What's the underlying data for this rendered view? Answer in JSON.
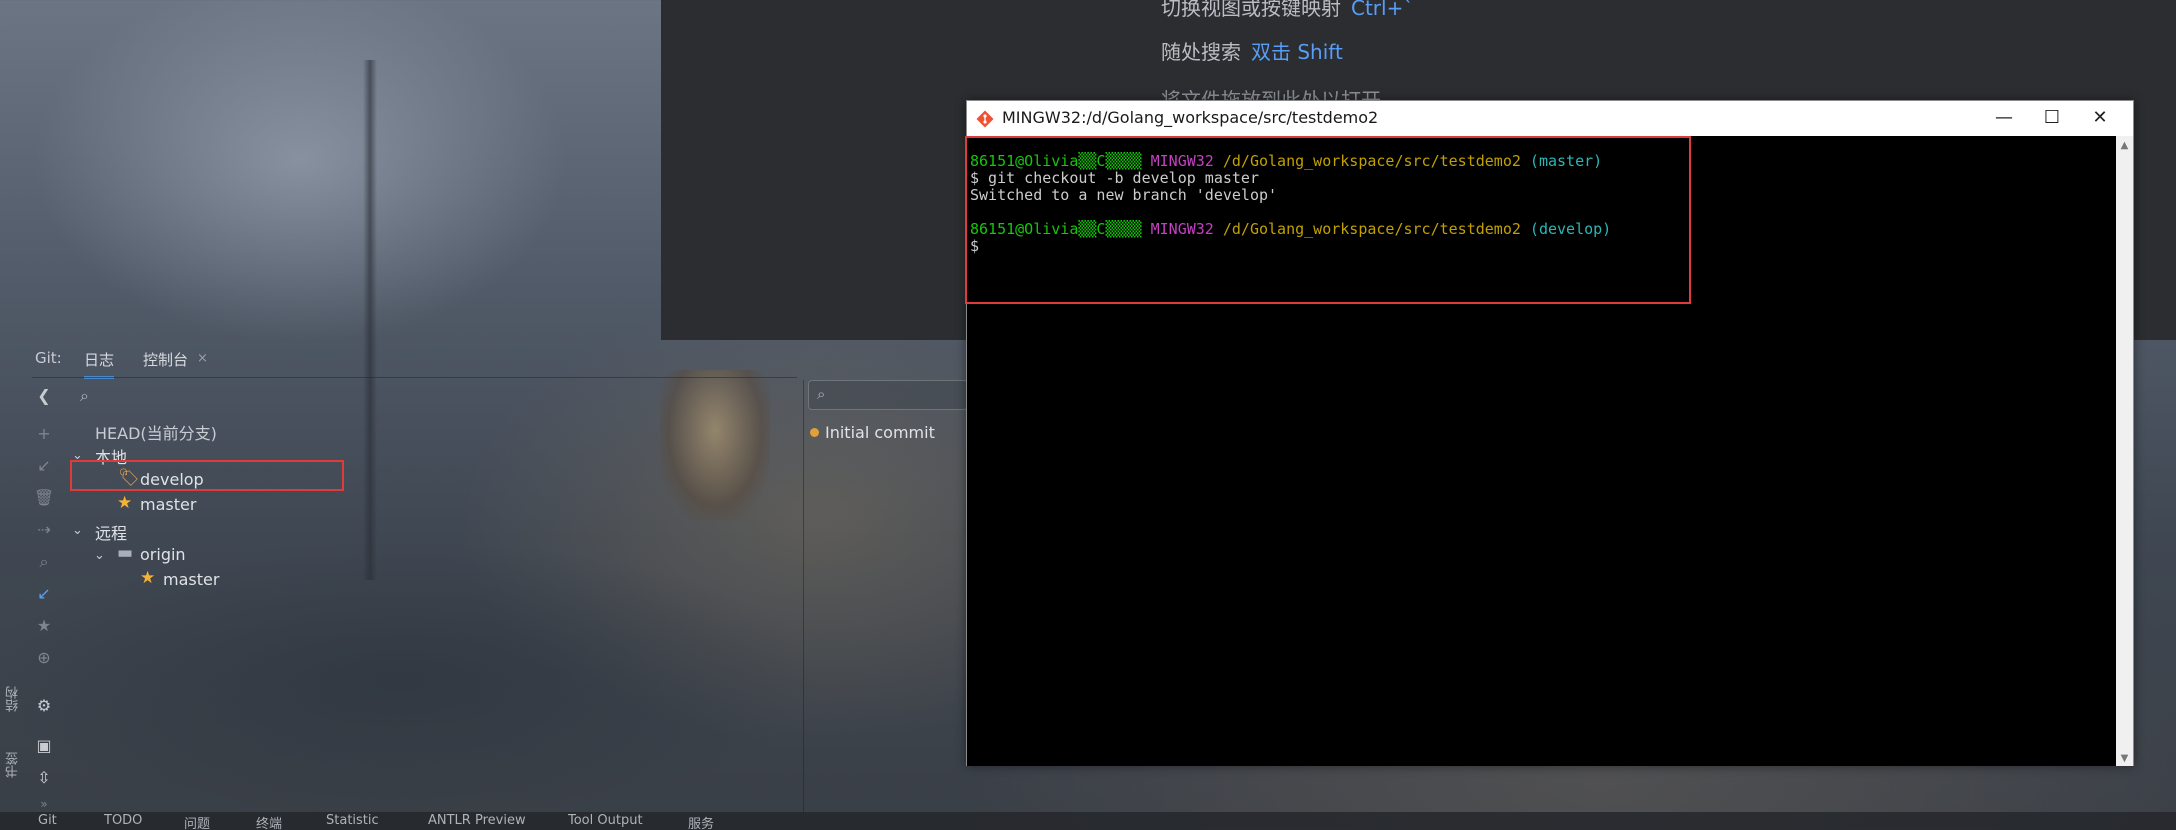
{
  "welcome": {
    "hint1_text": "切换视图或按键映射",
    "hint1_key": "Ctrl+`",
    "hint2_text": "随处搜索",
    "hint2_key": "双击 Shift",
    "hint3_text": "将文件拖放到此处以打开"
  },
  "git_panel": {
    "prefix": "Git:",
    "tabs": [
      {
        "label": "日志"
      },
      {
        "label": "控制台"
      }
    ],
    "tab_close": "×"
  },
  "branch_tree": {
    "head": "HEAD(当前分支)",
    "local_label": "本地",
    "local_branches": [
      {
        "label": "develop",
        "icon": "tag-icon"
      },
      {
        "label": "master",
        "icon": "star-icon"
      }
    ],
    "remote_label": "远程",
    "remote_folder": "origin",
    "remote_branches": [
      {
        "label": "master",
        "icon": "star-icon"
      }
    ]
  },
  "commit_log": {
    "commits": [
      {
        "message": "Initial commit",
        "dot_color": "#e0a13a"
      }
    ]
  },
  "side_labels": {
    "structure": "结构",
    "bookmarks": "书签"
  },
  "status_bar": {
    "items": [
      "Git",
      "TODO",
      "问题",
      "终端",
      "Statistic",
      "ANTLR Preview",
      "Tool Output",
      "服务"
    ]
  },
  "terminal": {
    "title": "MINGW32:/d/Golang_workspace/src/testdemo2",
    "controls": {
      "minimize": "—",
      "maximize": "☐",
      "close": "✕"
    },
    "lines": {
      "p1_user": "86151@Olivia▒▒C▒▒▒▒",
      "p1_system": "MINGW32",
      "p1_path": "/d/Golang_workspace/src/testdemo2",
      "p1_branch": "(master)",
      "cmd1": "$ git checkout -b develop master",
      "out1": "Switched to a new branch 'develop'",
      "p2_user": "86151@Olivia▒▒C▒▒▒▒",
      "p2_system": "MINGW32",
      "p2_path": "/d/Golang_workspace/src/testdemo2",
      "p2_branch": "(develop)",
      "cursor": "$"
    }
  },
  "colors": {
    "accent_blue": "#589df6",
    "highlight_red": "#e03b3b",
    "terminal_bg": "#000000",
    "prompt_green": "#16c60c",
    "prompt_magenta": "#c341c3",
    "prompt_yellow": "#c1a000",
    "prompt_cyan": "#2bb6b6"
  }
}
